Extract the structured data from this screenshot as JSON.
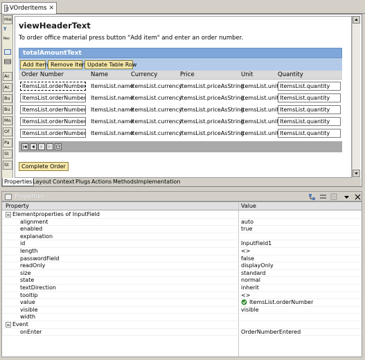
{
  "editor": {
    "tab_title": "VOrderItems"
  },
  "palette": {
    "items": [
      "Hie",
      "T",
      "Rec",
      "",
      "",
      "Ac",
      "Ac",
      "Bu",
      "Bu",
      "Mo",
      "Of",
      "Pa",
      "St",
      "St"
    ]
  },
  "view": {
    "header": "viewHeaderText",
    "description": "To order office material press button \"Add item\" and enter an order number.",
    "table_title": "totalAmountText",
    "toolbar": {
      "add_item": "Add Item",
      "remove_item": "Remove Item",
      "update_table_row": "Update Table Row"
    },
    "columns": [
      "Order Number",
      "Name",
      "Currency",
      "Price",
      "Unit",
      "Quantity"
    ],
    "rows": [
      {
        "order": "ItemsList.orderNumber",
        "name": "ItemsList.name",
        "currency": "ItemsList.currency",
        "price": "ItemsList.priceAsString",
        "unit": "ItemsList.unit",
        "quantity": "ItemsList.quantity"
      },
      {
        "order": "ItemsList.orderNumber",
        "name": "ItemsList.name",
        "currency": "ItemsList.currency",
        "price": "ItemsList.priceAsString",
        "unit": "ItemsList.unit",
        "quantity": "ItemsList.quantity"
      },
      {
        "order": "ItemsList.orderNumber",
        "name": "ItemsList.name",
        "currency": "ItemsList.currency",
        "price": "ItemsList.priceAsString",
        "unit": "ItemsList.unit",
        "quantity": "ItemsList.quantity"
      },
      {
        "order": "ItemsList.orderNumber",
        "name": "ItemsList.name",
        "currency": "ItemsList.currency",
        "price": "ItemsList.priceAsString",
        "unit": "ItemsList.unit",
        "quantity": "ItemsList.quantity"
      },
      {
        "order": "ItemsList.orderNumber",
        "name": "ItemsList.name",
        "currency": "ItemsList.currency",
        "price": "ItemsList.priceAsString",
        "unit": "ItemsList.unit",
        "quantity": "ItemsList.quantity"
      }
    ],
    "complete_button": "Complete Order"
  },
  "bottom_tabs": [
    "Properties",
    "Layout",
    "Context",
    "Plugs",
    "Actions",
    "Methods",
    "Implementation"
  ],
  "properties": {
    "title": "Properties",
    "col_property": "Property",
    "col_value": "Value",
    "rows": [
      {
        "name": "Elementproperties of InputField",
        "value": "",
        "kind": "group"
      },
      {
        "name": "alignment",
        "value": "auto",
        "kind": "prop"
      },
      {
        "name": "enabled",
        "value": "true",
        "kind": "prop"
      },
      {
        "name": "explanation",
        "value": "",
        "kind": "prop"
      },
      {
        "name": "id",
        "value": "InputField1",
        "kind": "prop"
      },
      {
        "name": "length",
        "value": "<>",
        "kind": "prop"
      },
      {
        "name": "passwordField",
        "value": "false",
        "kind": "prop"
      },
      {
        "name": "readOnly",
        "value": "displayOnly",
        "kind": "prop"
      },
      {
        "name": "size",
        "value": "standard",
        "kind": "prop"
      },
      {
        "name": "state",
        "value": "normal",
        "kind": "prop"
      },
      {
        "name": "textDirection",
        "value": "inherit",
        "kind": "prop"
      },
      {
        "name": "tooltip",
        "value": "<>",
        "kind": "prop"
      },
      {
        "name": "value",
        "value": "ItemsList.orderNumber",
        "kind": "prop",
        "icon": "binding-check-icon"
      },
      {
        "name": "visible",
        "value": "visible",
        "kind": "prop"
      },
      {
        "name": "width",
        "value": "",
        "kind": "prop"
      },
      {
        "name": "Event",
        "value": "",
        "kind": "group"
      },
      {
        "name": "onEnter",
        "value": "OrderNumberEntered",
        "kind": "prop"
      }
    ]
  },
  "colors": {
    "table_title_bg": "#7ea6d8",
    "toolbar_bg": "#b3cbe8",
    "button_bg": "#f6e7a8",
    "pager_bg": "#a9a9a9"
  }
}
